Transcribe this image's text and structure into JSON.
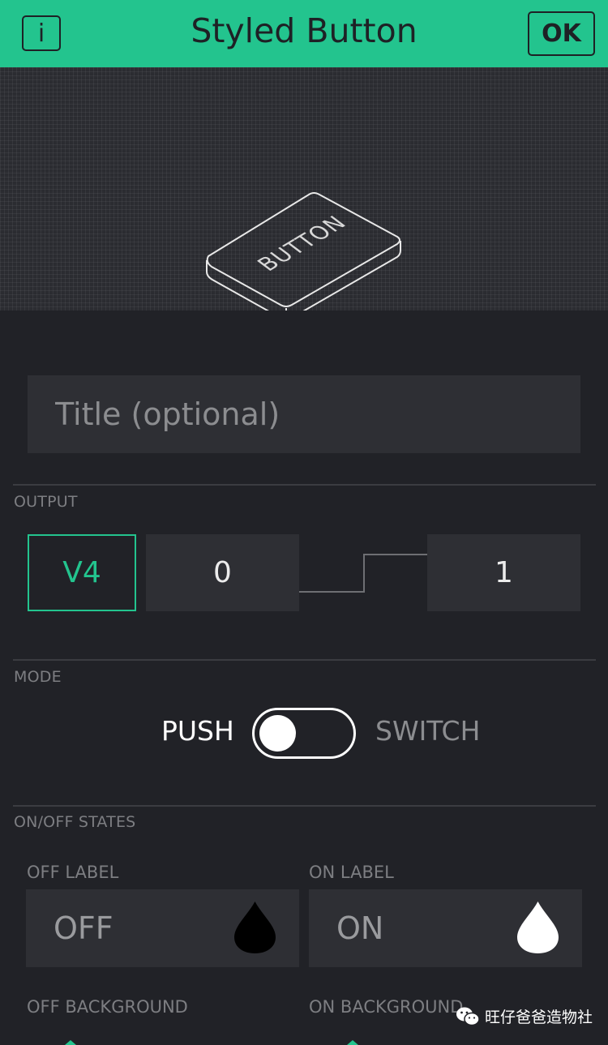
{
  "header": {
    "info_label": "i",
    "title": "Styled Button",
    "ok_label": "OK"
  },
  "preview": {
    "button_label": "BUTTON"
  },
  "title_field": {
    "placeholder": "Title (optional)",
    "value": ""
  },
  "output": {
    "section_label": "OUTPUT",
    "pin": "V4",
    "min": "0",
    "max": "1"
  },
  "mode": {
    "section_label": "MODE",
    "push_label": "PUSH",
    "switch_label": "SWITCH",
    "selected": "PUSH"
  },
  "states": {
    "section_label": "ON/OFF STATES",
    "off_label_heading": "OFF LABEL",
    "on_label_heading": "ON LABEL",
    "off_value": "OFF",
    "on_value": "ON",
    "off_color": "#000000",
    "on_color": "#ffffff",
    "off_background_heading": "OFF BACKGROUND",
    "on_background_heading": "ON BACKGROUND"
  },
  "watermark": {
    "icon": "wechat-icon",
    "text": "旺仔爸爸造物社"
  },
  "colors": {
    "accent": "#23c48e",
    "background": "#212227",
    "field": "#2e2f34"
  }
}
